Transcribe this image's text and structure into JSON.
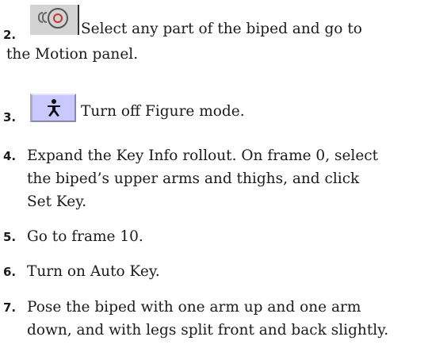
{
  "steps": [
    {
      "number": "2.",
      "icon": "motion-panel-icon",
      "lines": [
        "Select any part of the biped and go to",
        "the Motion panel."
      ]
    },
    {
      "number": "3.",
      "icon": "figure-mode-icon",
      "lines": [
        "Turn off Figure mode."
      ]
    },
    {
      "number": "4.",
      "lines": [
        "Expand the Key Info rollout. On frame 0, select",
        "the biped’s upper arms and thighs, and click",
        "Set Key."
      ]
    },
    {
      "number": "5.",
      "lines": [
        "Go to frame 10."
      ]
    },
    {
      "number": "6.",
      "lines": [
        "Turn on Auto Key."
      ]
    },
    {
      "number": "7.",
      "lines": [
        "Pose the biped with one arm up and one arm",
        "down, and with legs split front and back slightly."
      ]
    }
  ],
  "colors": {
    "text": "#1b1b1b",
    "motion_icon_bg": "#d3d3d3",
    "figure_icon_bg": "#c9c9ff"
  }
}
